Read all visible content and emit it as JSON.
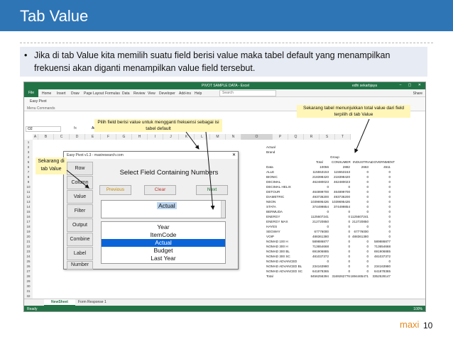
{
  "slide": {
    "title": "Tab Value",
    "bullet_symbol": "•",
    "bullet_text": "Jika di tab Value kita memilih suatu field berisi value maka tabel default yang menampilkan frekuensi akan diganti menampilkan value field tersebut.",
    "brand": "maxi",
    "page_number": "10"
  },
  "callouts": {
    "left": "Sekarang di tab Value",
    "middle": "Pilih field berisi value untuk mengganti frekuensi sebagai isi tabel default",
    "right": "Sekarang tabel menunjukkan total value dari field terpilih di tab Value"
  },
  "excel": {
    "doc_title": "PIVOT SAMPLE DATA - Excel",
    "user": "edhi sekarbjaya",
    "window_controls": "– ▢ ✕",
    "file_tab": "File",
    "menu": [
      "Home",
      "Insert",
      "Draw",
      "Page Layout",
      "Formulas",
      "Data",
      "Review",
      "View",
      "Developer",
      "Add-ins",
      "Help"
    ],
    "tell_me": "Search",
    "share": "Share",
    "ribbon_item": "Easy Pivot",
    "ribbon_group": "Menu Commands",
    "name_box": "O2",
    "fx": "fx",
    "formula_value": "Actual",
    "columns": [
      "A",
      "B",
      "C",
      "D",
      "E",
      "F",
      "G",
      "H",
      "I",
      "J",
      "K",
      "L",
      "M",
      "N",
      "O",
      "P",
      "Q",
      "R",
      "S",
      "T"
    ],
    "selected_column": "O",
    "rows": [
      "1",
      "2",
      "3",
      "4",
      "5",
      "6",
      "7",
      "8",
      "9",
      "10",
      "11",
      "12",
      "13",
      "14",
      "15",
      "16",
      "17",
      "18",
      "19",
      "20",
      "21",
      "22",
      "23",
      "24",
      "25",
      "26",
      "27",
      "28",
      "29",
      "30",
      "31",
      "32"
    ],
    "sheet_tabs": [
      "NewSheet",
      "Form Response 1"
    ],
    "status": "Ready",
    "zoom": "100%"
  },
  "table": {
    "label_actual": "Actual",
    "label_brand": "Brand",
    "label_group": "Group",
    "headers": [
      "Total",
      "CONSUMER",
      "INDUSTRIAL",
      "GOVERNMENT"
    ],
    "rows": [
      [
        "Data",
        "10056",
        "2882",
        "2663",
        "4511"
      ],
      [
        "ALLE",
        "115553153",
        "115553153",
        "0",
        "0"
      ],
      [
        "BIONIC",
        "218398420",
        "218398420",
        "0",
        "0"
      ],
      [
        "DECIMAL",
        "462480023",
        "462480023",
        "0",
        "0"
      ],
      [
        "DECIMAL HELIX",
        "0",
        "0",
        "0",
        "0"
      ],
      [
        "DETOUR",
        "464899700",
        "464899700",
        "0",
        "0"
      ],
      [
        "DIAMETRIC",
        "493736200",
        "493736200",
        "0",
        "0"
      ],
      [
        "NEON",
        "1039695426",
        "1039695426",
        "0",
        "0"
      ],
      [
        "STATA",
        "374499854",
        "374499854",
        "0",
        "0"
      ],
      [
        "BERMUDA",
        "0",
        "0",
        "0",
        "0"
      ],
      [
        "ENERGY",
        "1125607241",
        "0",
        "1125607241",
        "0"
      ],
      [
        "ENERGY MAX",
        "212720850",
        "0",
        "212720850",
        "0"
      ],
      [
        "HAYES",
        "0",
        "0",
        "0",
        "0"
      ],
      [
        "SEGWAY",
        "67776000",
        "0",
        "67776000",
        "0"
      ],
      [
        "VOIP",
        "488361380",
        "0",
        "488361380",
        "0"
      ],
      [
        "NOMAD 100 H",
        "589886877",
        "0",
        "0",
        "589886877"
      ],
      [
        "NOMAD 300 H",
        "713654668",
        "0",
        "0",
        "713654668"
      ],
      [
        "NOMAD 300 BL",
        "691906885",
        "0",
        "0",
        "691906885"
      ],
      [
        "NOMAD 300 SC",
        "481037372",
        "0",
        "0",
        "481037372"
      ],
      [
        "NOMAD ADVANCED",
        "0",
        "0",
        "0",
        "0"
      ],
      [
        "NOMAD ADVANCED BL",
        "234163980",
        "0",
        "0",
        "234163980"
      ],
      [
        "NOMAD ADVANCED SC",
        "641878365",
        "0",
        "0",
        "641878365"
      ],
      [
        "Total",
        "8456256394",
        "3169262776",
        "1894465471",
        "3352528147"
      ]
    ]
  },
  "dialog": {
    "title": "Easy Pivot v1.3 - maxiresearch.com",
    "close": "✕",
    "side_buttons": [
      "Row",
      "Column",
      "Value",
      "Filter",
      "Output",
      "Combine",
      "Label",
      "Number"
    ],
    "heading": "Select Field Containing Numbers",
    "previous": "Previous",
    "clear": "Clear",
    "next": "Next",
    "selected_value": "Actual",
    "list": [
      "Year",
      "ItemCode",
      "Actual",
      "Budget",
      "Last Year"
    ],
    "list_selected_index": 2
  }
}
